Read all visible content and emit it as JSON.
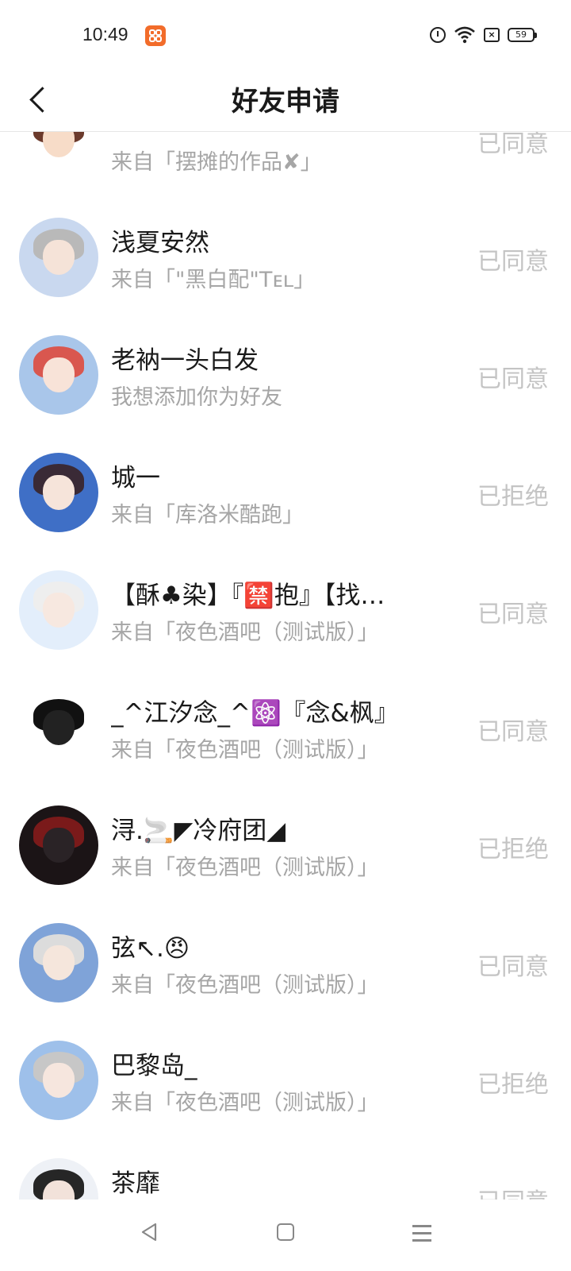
{
  "status_bar": {
    "time": "10:49",
    "battery": "59"
  },
  "header": {
    "title": "好友申请"
  },
  "requests": [
    {
      "name": "",
      "source": "来自「摆摊的作品✘」",
      "status": "已同意",
      "avatar": {
        "bg": "#ffffff",
        "hair": "#6b3a2c",
        "face": "#f7dcc8"
      }
    },
    {
      "name": "浅夏安然",
      "source": "来自「\"黑白配\"Tᴇʟ」",
      "status": "已同意",
      "avatar": {
        "bg": "#c9d8ef",
        "hair": "#b9b9b9",
        "face": "#f5e3d8"
      }
    },
    {
      "name": "老衲一头白发",
      "source": "我想添加你为好友",
      "status": "已同意",
      "avatar": {
        "bg": "#a9c6ea",
        "hair": "#d9574f",
        "face": "#f8e3d8"
      }
    },
    {
      "name": "城一",
      "source": "来自「库洛米酷跑」",
      "status": "已拒绝",
      "avatar": {
        "bg": "#3f6fc6",
        "hair": "#3a2a36",
        "face": "#f6e4da"
      }
    },
    {
      "name": "【酥♣染】『🈲抱』【找…",
      "source": "来自「夜色酒吧（测试版）」",
      "status": "已同意",
      "avatar": {
        "bg": "#e3eefb",
        "hair": "#eeeeee",
        "face": "#f7e8e0"
      }
    },
    {
      "name": "_^江汐念_^⚛️『念&枫』",
      "source": "来自「夜色酒吧（测试版）」",
      "status": "已同意",
      "avatar": {
        "bg": "#ffffff",
        "hair": "#111111",
        "face": "#222222"
      }
    },
    {
      "name": "浔.🚬◤冷府团◢",
      "source": "来自「夜色酒吧（测试版）」",
      "status": "已拒绝",
      "avatar": {
        "bg": "#1b1416",
        "hair": "#7a1a1a",
        "face": "#2a2326"
      }
    },
    {
      "name": "弦↖.😠",
      "source": "来自「夜色酒吧（测试版）」",
      "status": "已同意",
      "avatar": {
        "bg": "#7fa3d8",
        "hair": "#dcdcdc",
        "face": "#f5e6dc"
      }
    },
    {
      "name": "巴黎岛_",
      "source": "来自「夜色酒吧（测试版）」",
      "status": "已拒绝",
      "avatar": {
        "bg": "#9ec0ea",
        "hair": "#c7c7c7",
        "face": "#f6e6de"
      }
    },
    {
      "name": "茶靡",
      "source": "",
      "status": "已同意",
      "avatar": {
        "bg": "#eef1f6",
        "hair": "#262626",
        "face": "#f2e2da"
      }
    }
  ],
  "icons": {
    "back": "chevron-left-icon",
    "alarm": "alarm-icon",
    "wifi": "wifi-icon",
    "sim": "no-sim-icon",
    "battery": "battery-icon",
    "nav_back": "triangle-back-icon",
    "nav_home": "square-home-icon",
    "nav_menu": "menu-lines-icon"
  }
}
